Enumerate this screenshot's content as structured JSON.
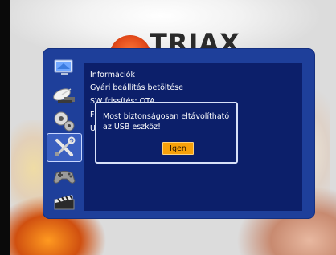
{
  "background": {
    "brand_logo_text": "TRIAX"
  },
  "sidebar": {
    "icons": [
      {
        "name": "monitor-icon",
        "selected": false
      },
      {
        "name": "satellite-dish-icon",
        "selected": false
      },
      {
        "name": "gears-icon",
        "selected": false
      },
      {
        "name": "tools-icon",
        "selected": true
      },
      {
        "name": "gamepad-icon",
        "selected": false
      },
      {
        "name": "clapperboard-icon",
        "selected": false
      }
    ]
  },
  "menu": {
    "items": [
      {
        "label": "Információk"
      },
      {
        "label": "Gyári beállítás betöltése"
      },
      {
        "label": "SW frissítés: OTA"
      },
      {
        "label": "F"
      },
      {
        "label": "U"
      }
    ]
  },
  "dialog": {
    "message": "Most biztonságosan eltávolítható az USB eszköz!",
    "ok_label": "Igen"
  },
  "colors": {
    "panel_blue": "#1e3f9a",
    "content_navy": "#0c1f6a",
    "button_orange": "#f7a10a",
    "logo_red": "#e24a1a"
  }
}
